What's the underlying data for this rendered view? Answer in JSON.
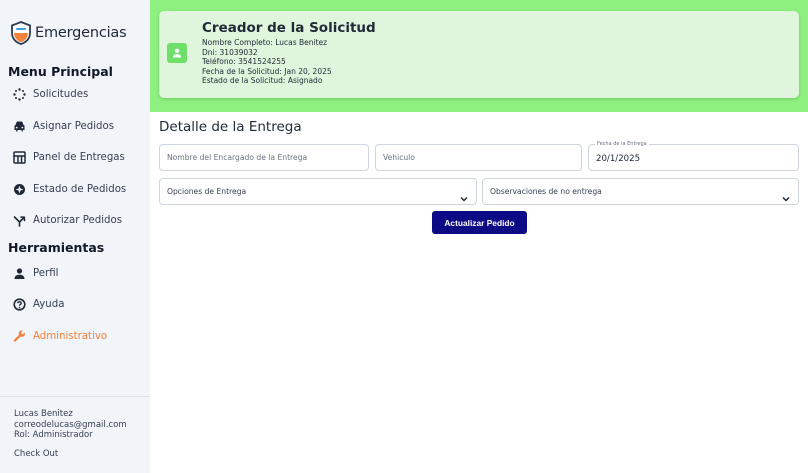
{
  "app": {
    "title": "Emergencias"
  },
  "sidebar": {
    "section_main": "Menu Principal",
    "main_items": [
      {
        "label": "Solicitudes",
        "icon": "sparkle-icon"
      },
      {
        "label": "Asignar Pedidos",
        "icon": "car-icon"
      },
      {
        "label": "Panel de Entregas",
        "icon": "grid-panel-icon"
      },
      {
        "label": "Estado de Pedidos",
        "icon": "status-circle-icon"
      },
      {
        "label": "Autorizar Pedidos",
        "icon": "branch-arrow-icon"
      }
    ],
    "section_tools": "Herramientas",
    "tool_items": [
      {
        "label": "Perfil",
        "icon": "person-icon"
      },
      {
        "label": "Ayuda",
        "icon": "help-icon"
      },
      {
        "label": "Administrativo",
        "icon": "wrench-icon",
        "active": true
      }
    ],
    "user": {
      "name": "Lucas Benitez",
      "email": "correodelucas@gmail.com",
      "role": "Rol: Administrador",
      "checkout": "Check Out"
    }
  },
  "request_card": {
    "title": "Creador de la Solicitud",
    "full_name": "Nombre Completo: Lucas Benitez",
    "dni": "Dni: 31039032",
    "phone": "Teléfono: 3541524255",
    "date": "Fecha de la Solicitud: Jan 20, 2025",
    "status": "Estado de la Solicitud: Asignado"
  },
  "delivery": {
    "heading": "Detalle de la Entrega",
    "manager_placeholder": "Nombre del Encargado de la Entrega",
    "vehicle_placeholder": "Vehiculo",
    "date_label": "Fecha de la Entrega",
    "date_value": "20/1/2025",
    "options_placeholder": "Opciones de Entrega",
    "observations_placeholder": "Observaciones de no entrega",
    "submit_label": "Actualizar Pedido"
  },
  "colors": {
    "banner": "#8ef07e",
    "card": "#dff5dc",
    "accent_button": "#0d0a86",
    "active_nav": "#f2813b"
  }
}
